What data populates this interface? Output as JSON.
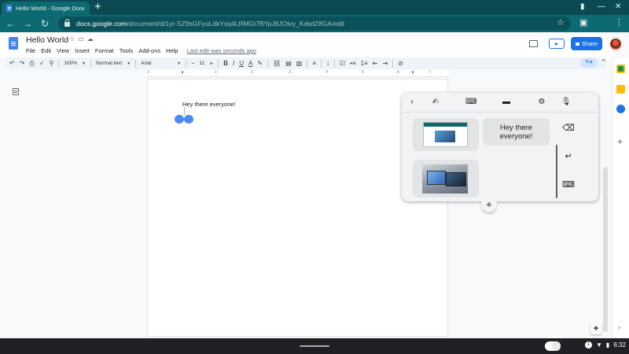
{
  "browser": {
    "tab_title": "Hello World - Google Docs",
    "tab_close": "×",
    "new_tab": "+",
    "url_host": "docs.google.com",
    "url_path": "/document/d/1yr-SZ9sGFyuLdkYsq4LRMGi7BYpJ8JOtvy_KdwtZ8GA/edit"
  },
  "docs": {
    "title": "Hello World",
    "menu": [
      "File",
      "Edit",
      "View",
      "Insert",
      "Format",
      "Tools",
      "Add-ons",
      "Help"
    ],
    "last_edit": "Last edit was seconds ago",
    "share_label": "Share",
    "toolbar": {
      "zoom": "100%",
      "style": "Normal text",
      "font": "Arial",
      "font_size": "11",
      "bold": "B",
      "italic": "I",
      "underline": "U",
      "text_color": "A"
    },
    "ruler_numbers": [
      "1",
      "1",
      "2",
      "3",
      "4",
      "5",
      "6",
      "7"
    ],
    "body_text": "Hey there everyone!"
  },
  "keyboard": {
    "clipboard_text": "Hey there everyone!"
  },
  "system": {
    "time": "6:32",
    "notification_count": "1"
  },
  "colors": {
    "accent": "#1a73e8",
    "browser_frame": "#0d6a72",
    "shelf": "#202124"
  }
}
